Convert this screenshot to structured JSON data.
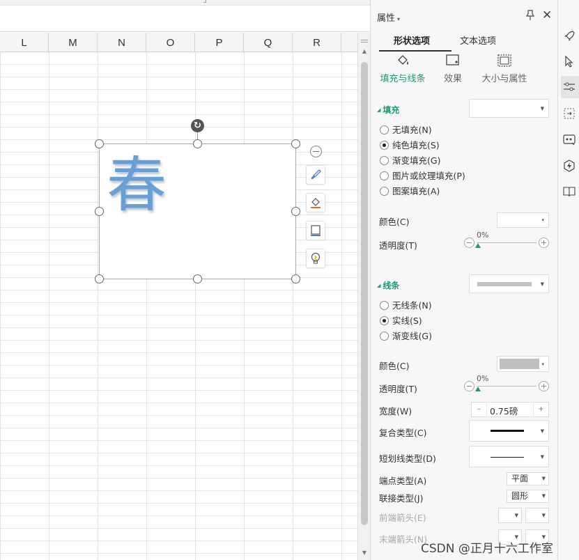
{
  "sheet": {
    "columns": [
      "L",
      "M",
      "N",
      "O",
      "P",
      "Q",
      "R"
    ],
    "shape_text": "春"
  },
  "panel": {
    "title": "属性",
    "tabs": [
      "形状选项",
      "文本选项"
    ],
    "subtabs": [
      "填充与线条",
      "效果",
      "大小与属性"
    ],
    "fill": {
      "section": "填充",
      "options": [
        "无填充(N)",
        "纯色填充(S)",
        "渐变填充(G)",
        "图片或纹理填充(P)",
        "图案填充(A)"
      ],
      "selected_index": 1,
      "color_label": "颜色(C)",
      "transparency_label": "透明度(T)",
      "transparency_value": "0%"
    },
    "line": {
      "section": "线条",
      "options": [
        "无线条(N)",
        "实线(S)",
        "渐变线(G)"
      ],
      "selected_index": 1,
      "color_label": "颜色(C)",
      "transparency_label": "透明度(T)",
      "transparency_value": "0%",
      "width_label": "宽度(W)",
      "width_value": "0.75磅",
      "compound_label": "复合类型(C)",
      "dash_label": "短划线类型(D)",
      "cap_label": "端点类型(A)",
      "cap_value": "平面",
      "join_label": "联接类型(J)",
      "join_value": "圆形",
      "begin_arrow_label": "前端箭头(E)",
      "end_arrow_label": "末端箭头(N)",
      "line_swatch_color": "#bfbfbf"
    }
  },
  "accent_color": "#1a9e6e",
  "watermark": "CSDN @正月十六工作室"
}
